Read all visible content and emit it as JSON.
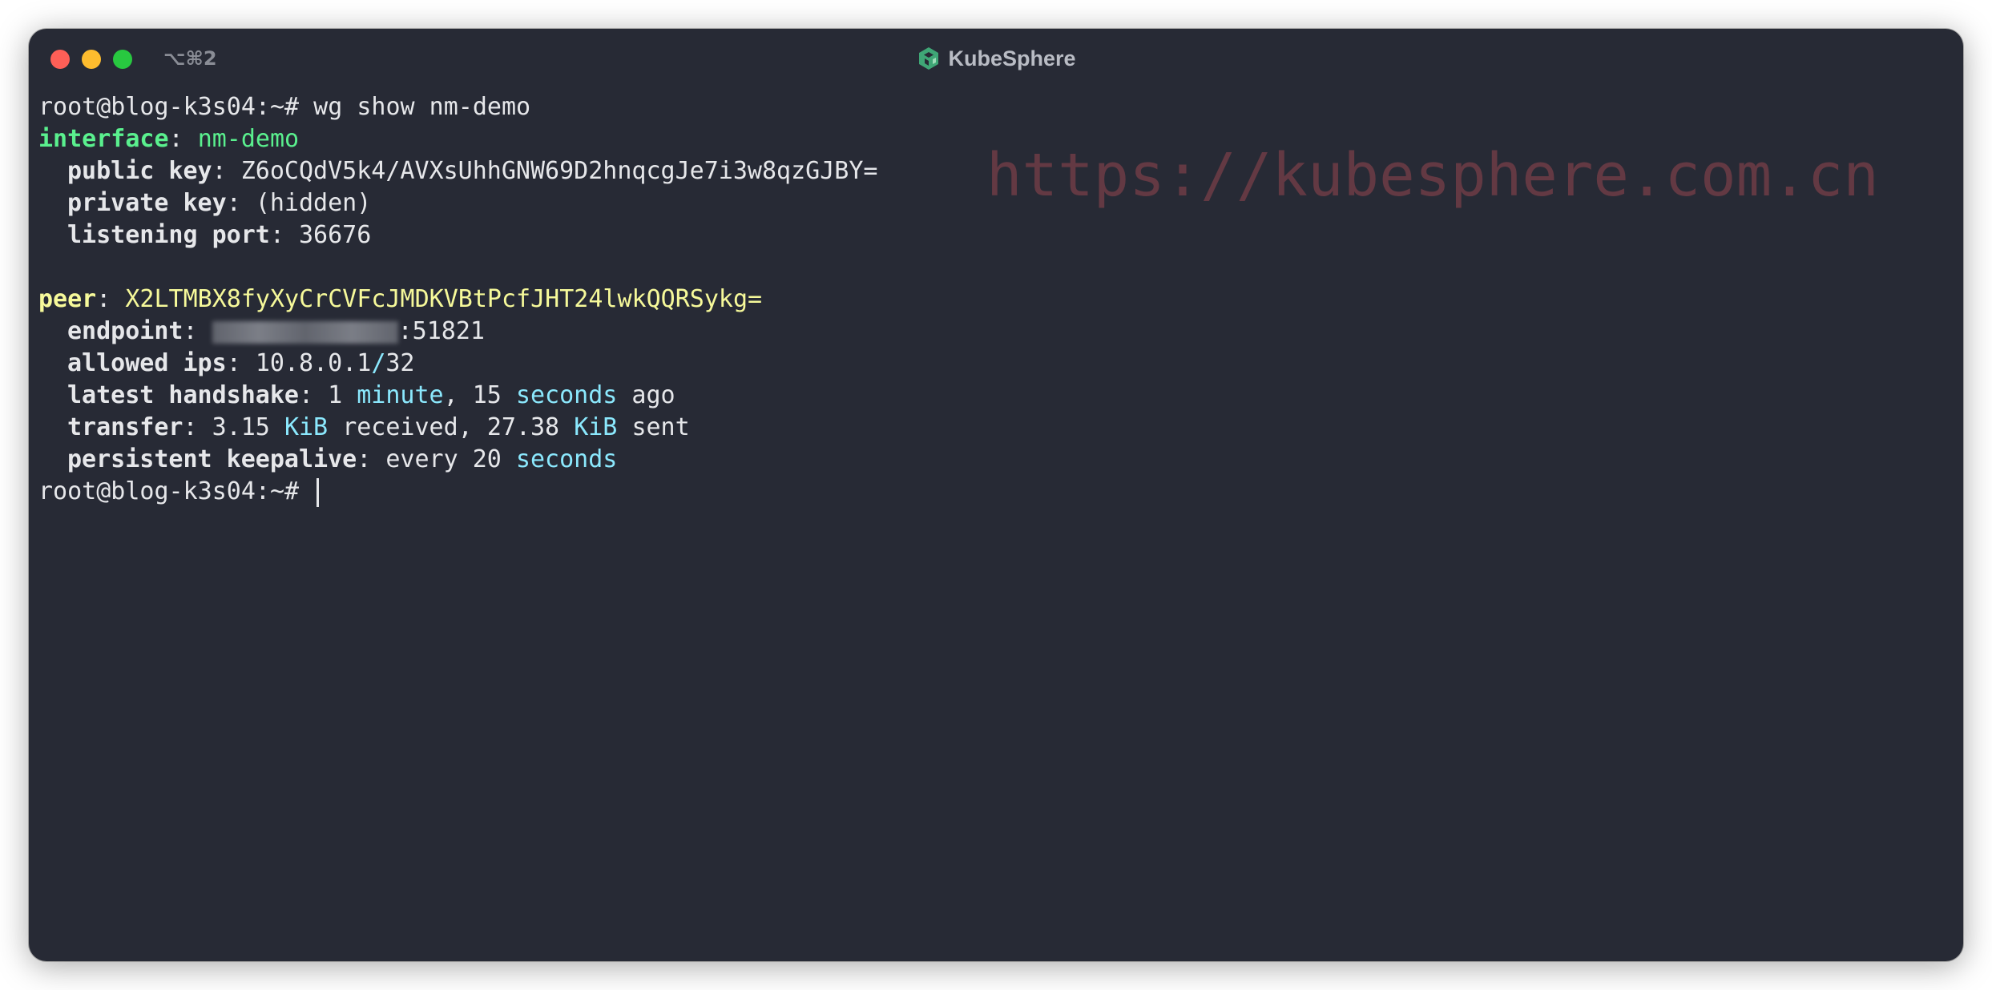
{
  "window": {
    "shortcut": "⌥⌘2",
    "brand": "KubeSphere"
  },
  "watermark": "https://kubesphere.com.cn",
  "terminal": {
    "prompt": "root@blog-k3s04:~#",
    "command": "wg show nm-demo",
    "interface_label": "interface",
    "interface_name": "nm-demo",
    "public_key_label": "public key",
    "public_key": "Z6oCQdV5k4/AVXsUhhGNW69D2hnqcgJe7i3w8qzGJBY=",
    "private_key_label": "private key",
    "private_key": "(hidden)",
    "listening_port_label": "listening port",
    "listening_port": "36676",
    "peer_label": "peer",
    "peer_key": "X2LTMBX8fyXyCrCVFcJMDKVBtPcfJHT24lwkQQRSykg=",
    "endpoint_label": "endpoint",
    "endpoint_port": ":51821",
    "allowed_ips_label": "allowed ips",
    "allowed_ips_addr": "10.8.0.1",
    "allowed_ips_slash": "/",
    "allowed_ips_mask": "32",
    "handshake_label": "latest handshake",
    "handshake_n1": "1",
    "handshake_u1": "minute",
    "handshake_n2": "15",
    "handshake_u2": "seconds",
    "handshake_tail": "ago",
    "transfer_label": "transfer",
    "transfer_rx": "3.15",
    "transfer_rx_unit": "KiB",
    "transfer_rx_word": "received,",
    "transfer_tx": "27.38",
    "transfer_tx_unit": "KiB",
    "transfer_tx_word": "sent",
    "keepalive_label": "persistent keepalive",
    "keepalive_pre": "every 20",
    "keepalive_unit": "seconds"
  },
  "colors": {
    "background": "#272a35",
    "interface": "#5af08e",
    "peer": "#f6f99a",
    "unit": "#8be8fd",
    "watermark": "#6a3b45"
  }
}
